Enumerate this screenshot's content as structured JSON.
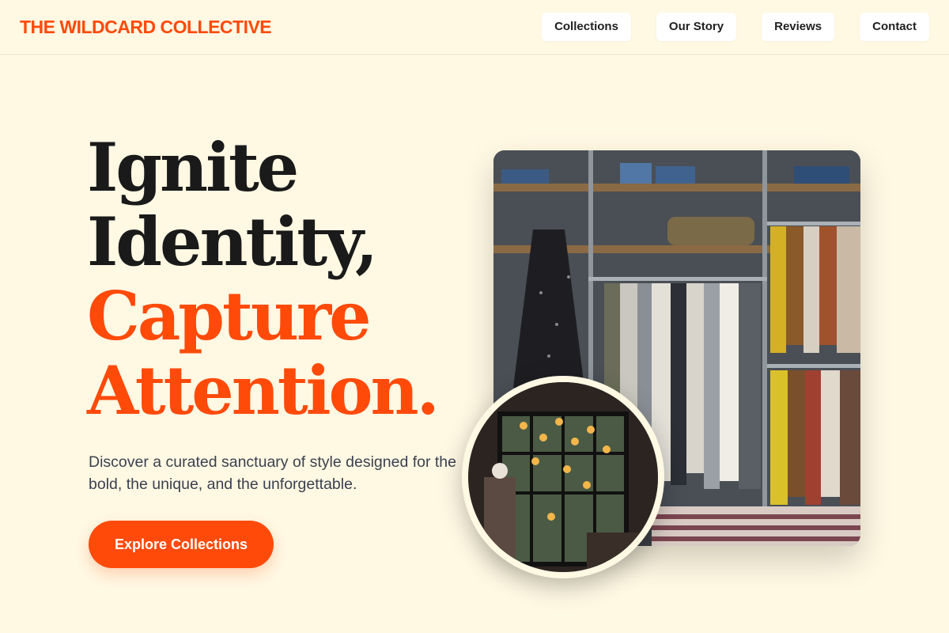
{
  "brand": {
    "name": "THE WILDCARD COLLECTIVE",
    "accent": "#ff4a0a",
    "background": "#fff8e3"
  },
  "nav": {
    "links": [
      "Collections",
      "Our Story",
      "Reviews",
      "Contact"
    ]
  },
  "hero": {
    "title_line1": "Ignite",
    "title_line2": "Identity,",
    "title_line3": "Capture",
    "title_line4": "Attention.",
    "subtitle": "Discover a curated sanctuary of style designed for the bold, the unique, and the unforgettable.",
    "cta_label": "Explore Collections"
  },
  "images": {
    "main_alt": "clothing-boutique-racks-photo",
    "circle_alt": "boutique-interior-lights-photo"
  }
}
